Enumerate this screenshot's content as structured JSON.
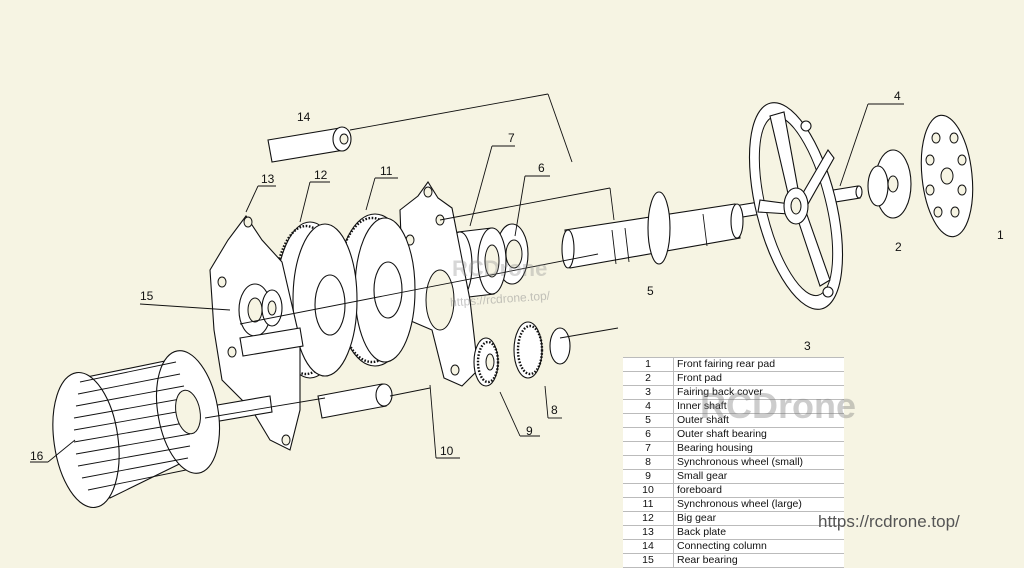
{
  "callouts": [
    {
      "num": "1"
    },
    {
      "num": "2"
    },
    {
      "num": "3"
    },
    {
      "num": "4"
    },
    {
      "num": "5"
    },
    {
      "num": "6"
    },
    {
      "num": "7"
    },
    {
      "num": "8"
    },
    {
      "num": "9"
    },
    {
      "num": "10"
    },
    {
      "num": "11"
    },
    {
      "num": "12"
    },
    {
      "num": "13"
    },
    {
      "num": "14"
    },
    {
      "num": "15"
    },
    {
      "num": "16"
    }
  ],
  "legend": [
    {
      "num": "1",
      "name": "Front fairing rear pad"
    },
    {
      "num": "2",
      "name": "Front pad"
    },
    {
      "num": "3",
      "name": "Fairing back cover"
    },
    {
      "num": "4",
      "name": "Inner shaft"
    },
    {
      "num": "5",
      "name": "Outer shaft"
    },
    {
      "num": "6",
      "name": "Outer shaft bearing"
    },
    {
      "num": "7",
      "name": "Bearing housing"
    },
    {
      "num": "8",
      "name": "Synchronous wheel (small)"
    },
    {
      "num": "9",
      "name": "Small gear"
    },
    {
      "num": "10",
      "name": "foreboard"
    },
    {
      "num": "11",
      "name": "Synchronous wheel (large)"
    },
    {
      "num": "12",
      "name": "Big gear"
    },
    {
      "num": "13",
      "name": "Back plate"
    },
    {
      "num": "14",
      "name": "Connecting column"
    },
    {
      "num": "15",
      "name": "Rear bearing"
    }
  ],
  "watermarks": {
    "brand": "RCDrone",
    "url": "https://rcdrone.top/",
    "center_brand": "RCDrone",
    "center_url": "https://rcdrone.top/"
  }
}
